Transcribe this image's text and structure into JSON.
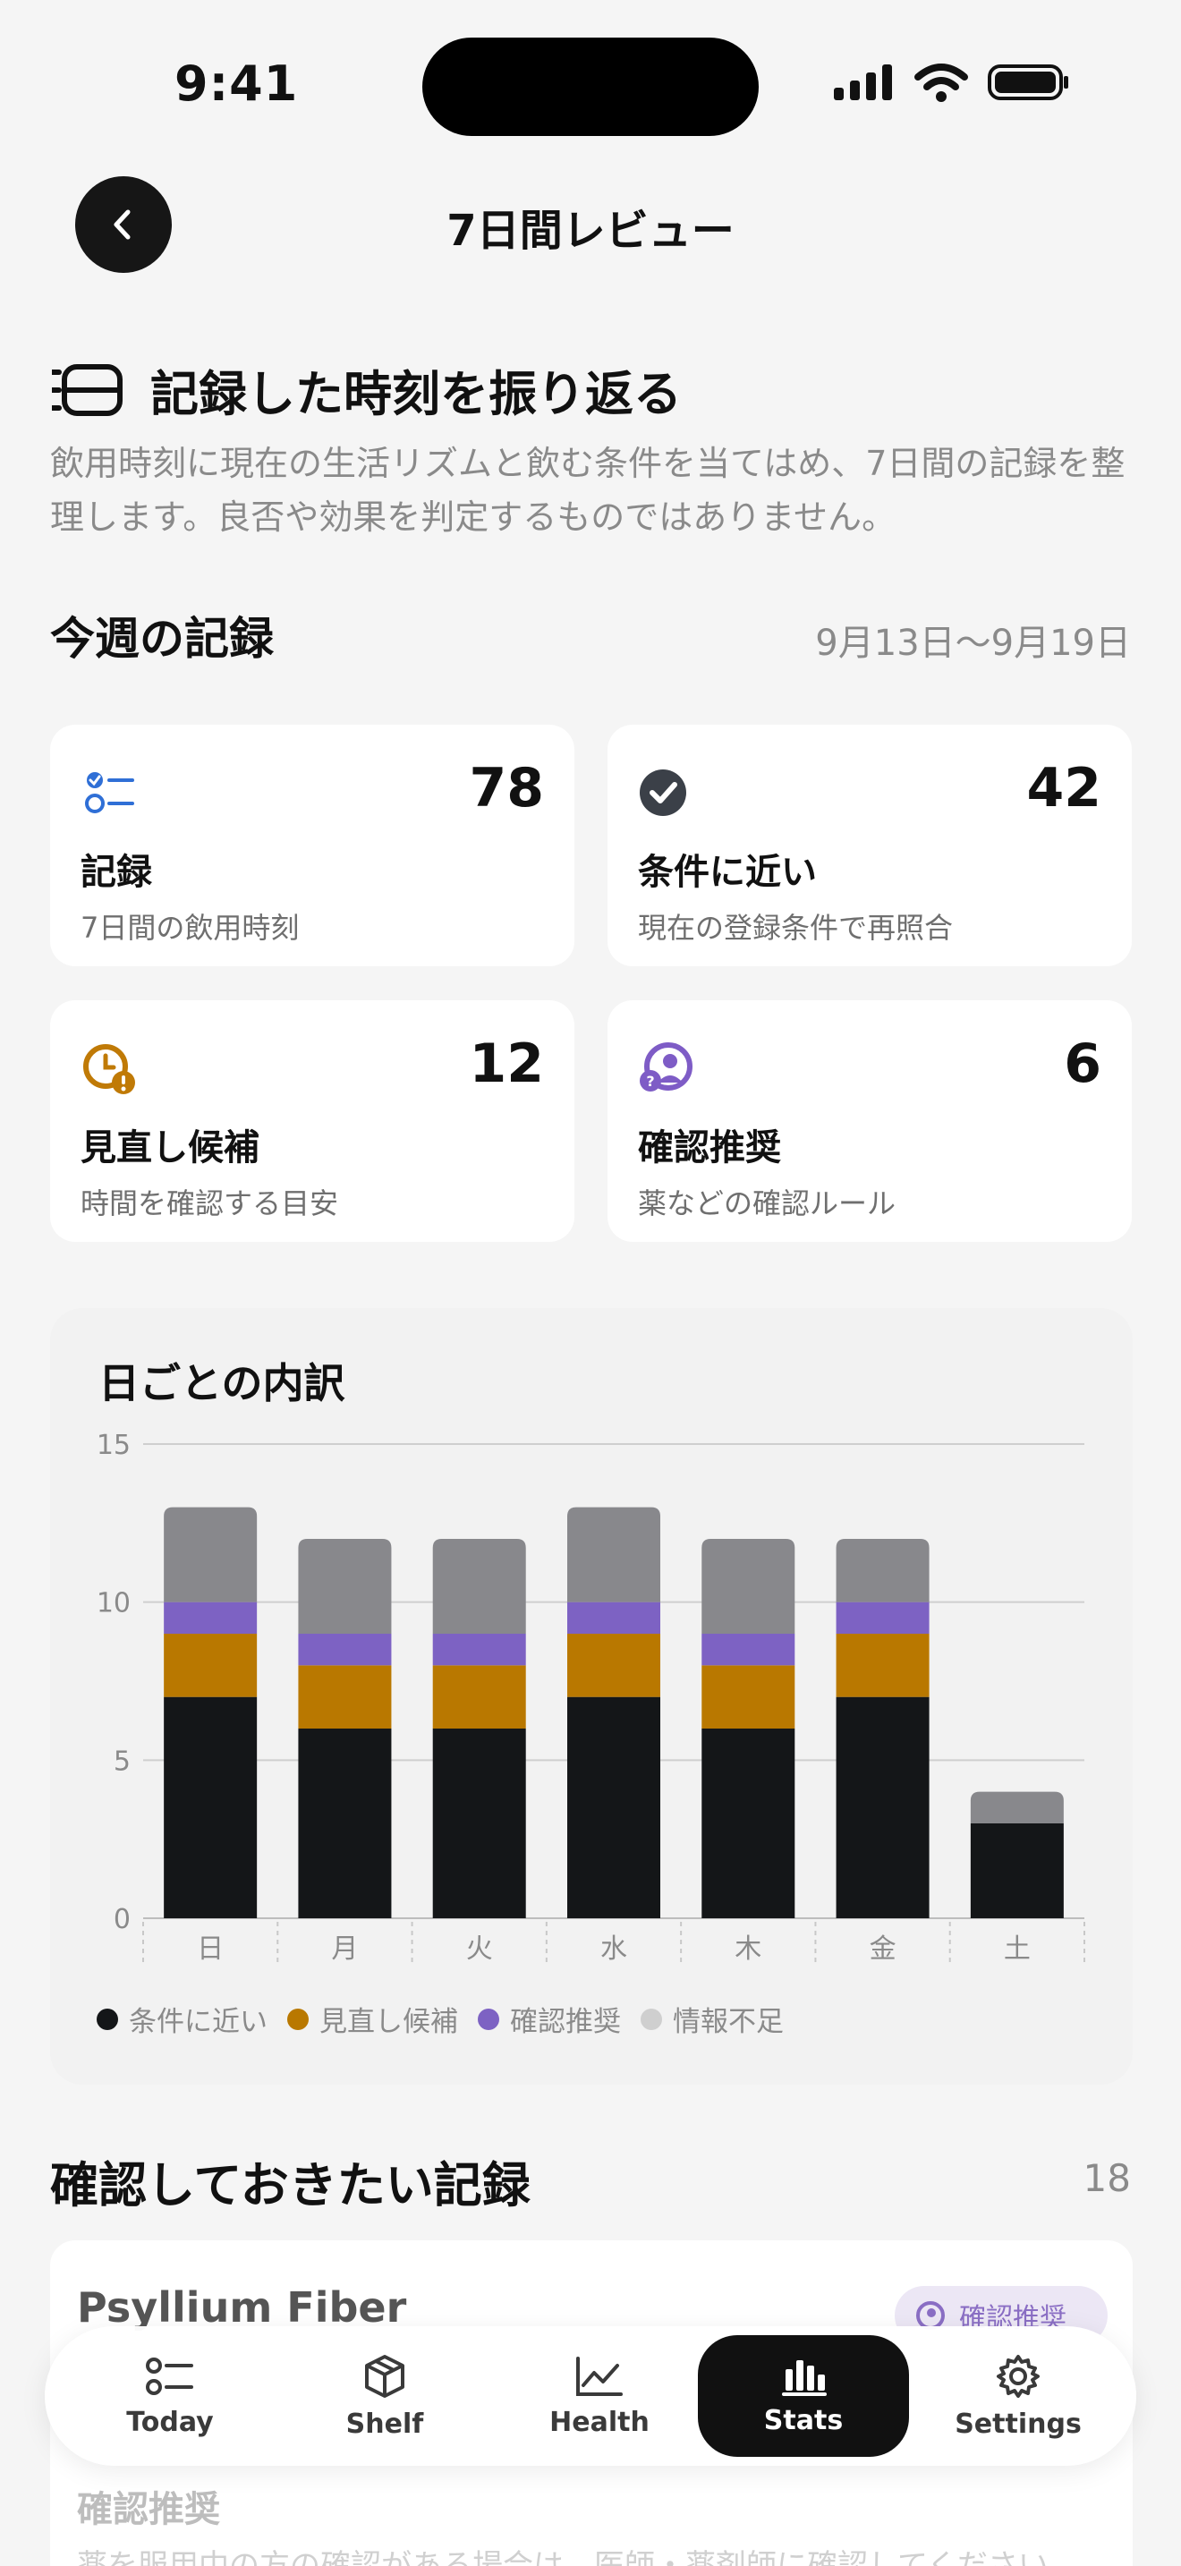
{
  "status_bar": {
    "time": "9:41"
  },
  "header": {
    "title": "7日間レビュー",
    "back_icon": "chevron-left-icon"
  },
  "hero": {
    "icon": "timeline-icon",
    "title": "記録した時刻を振り返る",
    "description": "飲用時刻に現在の生活リズムと飲む条件を当てはめ、7日間の記録を整理します。良否や効果を判定するものではありません。"
  },
  "week": {
    "title": "今週の記録",
    "range": "9月13日〜9月19日"
  },
  "stats": [
    {
      "icon": "checklist-icon",
      "value": "78",
      "label": "記録",
      "sub": "7日間の飲用時刻",
      "color": "#2f6fd6"
    },
    {
      "icon": "check-circle-icon",
      "value": "42",
      "label": "条件に近い",
      "sub": "現在の登録条件で再照合",
      "color": "#3b4048"
    },
    {
      "icon": "clock-alert-icon",
      "value": "12",
      "label": "見直し候補",
      "sub": "時間を確認する目安",
      "color": "#c07a06"
    },
    {
      "icon": "person-question-icon",
      "value": "6",
      "label": "確認推奨",
      "sub": "薬などの確認ルール",
      "color": "#7e5cc6"
    }
  ],
  "chart_data": {
    "type": "bar",
    "stacked": true,
    "title": "日ごとの内訳",
    "categories": [
      "日",
      "月",
      "火",
      "水",
      "木",
      "金",
      "土"
    ],
    "ylim": [
      0,
      15
    ],
    "yticks": [
      0,
      5,
      10,
      15
    ],
    "grid": true,
    "legend": "bottom",
    "series": [
      {
        "name": "条件に近い",
        "color": "#141618",
        "values": [
          7,
          6,
          6,
          7,
          6,
          7,
          3
        ]
      },
      {
        "name": "見直し候補",
        "color": "#b97800",
        "values": [
          2,
          2,
          2,
          2,
          2,
          2,
          0
        ]
      },
      {
        "name": "確認推奨",
        "color": "#7d62c3",
        "values": [
          1,
          1,
          1,
          1,
          1,
          1,
          0
        ]
      },
      {
        "name": "情報不足",
        "color": "#88888c",
        "values": [
          3,
          3,
          3,
          3,
          3,
          2,
          1
        ]
      }
    ]
  },
  "legend_dot_colors": [
    "#141618",
    "#b97800",
    "#7d62c3",
    "#cfcfcf"
  ],
  "review": {
    "title": "確認しておきたい記録",
    "count": "18",
    "item": {
      "name": "Psyllium Fiber",
      "badge": "確認推奨",
      "category": "確認推奨",
      "text": "薬を服用中の方の確認がある場合は、医師・薬剤師に確認してください"
    }
  },
  "tabs": [
    {
      "label": "Today",
      "icon": "checklist-icon",
      "active": false
    },
    {
      "label": "Shelf",
      "icon": "box-icon",
      "active": false
    },
    {
      "label": "Health",
      "icon": "chart-line-icon",
      "active": false
    },
    {
      "label": "Stats",
      "icon": "bar-chart-icon",
      "active": true
    },
    {
      "label": "Settings",
      "icon": "gear-icon",
      "active": false
    }
  ]
}
